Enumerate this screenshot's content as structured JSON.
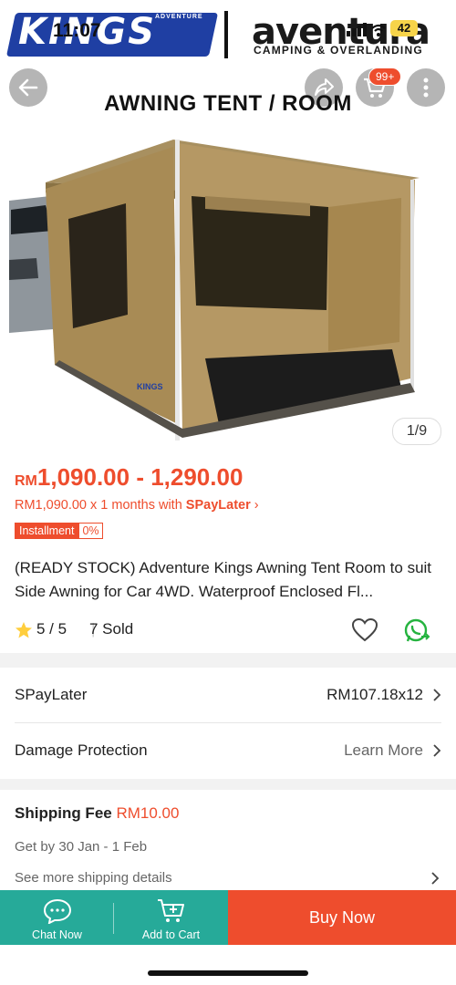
{
  "status": {
    "time": "11:07",
    "battery": "42"
  },
  "brand": {
    "left": "KINGS",
    "left_small": "ADVENTURE",
    "right": "aventura",
    "right_sub": "CAMPING & OVERLANDING"
  },
  "header": {
    "title": "AWNING TENT / ROOM",
    "cart_badge": "99+"
  },
  "image": {
    "counter": "1/9",
    "tag": "KINGS"
  },
  "price": {
    "currency": "RM",
    "range": "1,090.00 - 1,290.00"
  },
  "paylater": {
    "text": "RM1,090.00 x 1 months with ",
    "brand": "SPayLater",
    "chevron": "›"
  },
  "installment": {
    "label": "Installment",
    "rate": "0%"
  },
  "product": {
    "title": "(READY STOCK) Adventure Kings Awning Tent Room to suit Side Awning for Car 4WD. Waterproof Enclosed Fl..."
  },
  "rating": {
    "score": "5 / 5",
    "sold": "7 Sold",
    "separator": "|"
  },
  "rows": {
    "spaylater": {
      "label": "SPayLater",
      "value": "RM107.18x12"
    },
    "damage": {
      "label": "Damage Protection",
      "value": "Learn More"
    }
  },
  "shipping": {
    "label": "Shipping Fee",
    "fee": "RM10.00",
    "eta": "Get by 30 Jan - 1 Feb",
    "more": "See more shipping details"
  },
  "bottom": {
    "chat": "Chat Now",
    "cart": "Add to Cart",
    "buy": "Buy Now"
  },
  "colors": {
    "accent": "#ee4d2d",
    "teal": "#26aa99",
    "star": "#ffce3d",
    "whatsapp": "#25b33f"
  }
}
